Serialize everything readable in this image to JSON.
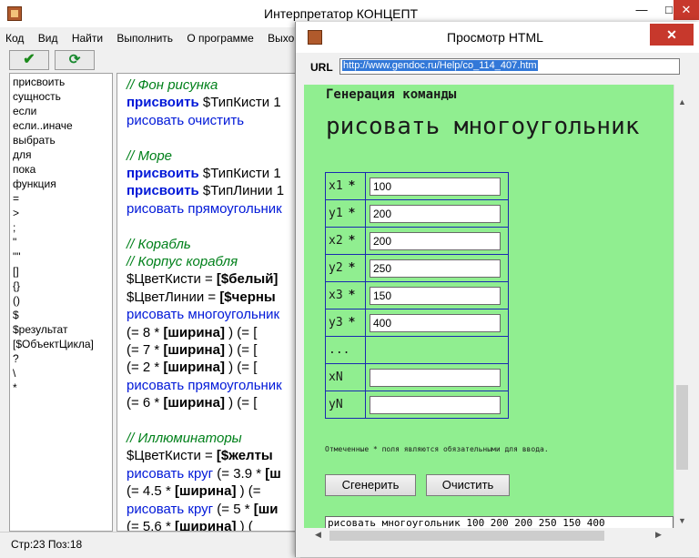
{
  "main": {
    "title": "Интерпретатор КОНЦЕПТ",
    "window_buttons": {
      "min": "—",
      "max": "□",
      "close": "✕"
    },
    "menu": [
      "Код",
      "Вид",
      "Найти",
      "Выполнить",
      "О программе",
      "Выхо"
    ],
    "toolbar": {
      "run_icon": "checkmark-icon",
      "refresh_icon": "refresh-icon",
      "run_glyph": "✔",
      "refresh_glyph": "⟳"
    },
    "keywords": [
      "присвоить",
      "сущность",
      "если",
      "если..иначе",
      "выбрать",
      "для",
      "пока",
      "функция",
      "=",
      ">",
      ";",
      "\"",
      "\"\"",
      "[]",
      "{}",
      "()",
      "$",
      "$результат",
      "[$ОбъектЦикла]",
      "?",
      "\\",
      "*"
    ],
    "editor_lines": [
      {
        "parts": [
          {
            "cls": "cmt",
            "text": "// Фон рисунка"
          }
        ]
      },
      {
        "parts": [
          {
            "cls": "kw",
            "text": "присвоить"
          },
          {
            "cls": "",
            "text": " $ТипКисти 1"
          }
        ]
      },
      {
        "parts": [
          {
            "cls": "cmd",
            "text": "рисовать очистить"
          }
        ]
      },
      {
        "parts": []
      },
      {
        "parts": [
          {
            "cls": "cmt",
            "text": "// Море"
          }
        ]
      },
      {
        "parts": [
          {
            "cls": "kw",
            "text": "присвоить"
          },
          {
            "cls": "",
            "text": " $ТипКисти 1"
          }
        ]
      },
      {
        "parts": [
          {
            "cls": "kw",
            "text": "присвоить"
          },
          {
            "cls": "",
            "text": " $ТипЛинии 1"
          }
        ]
      },
      {
        "parts": [
          {
            "cls": "cmd",
            "text": "рисовать прямоугольник"
          }
        ]
      },
      {
        "parts": []
      },
      {
        "parts": [
          {
            "cls": "cmt",
            "text": "// Корабль"
          }
        ]
      },
      {
        "parts": [
          {
            "cls": "cmt",
            "text": "// Корпус корабля"
          }
        ]
      },
      {
        "parts": [
          {
            "cls": "",
            "text": "$ЦветКисти = "
          },
          {
            "cls": "blk",
            "text": "[$белый]"
          }
        ]
      },
      {
        "parts": [
          {
            "cls": "",
            "text": "$ЦветЛинии = "
          },
          {
            "cls": "blk",
            "text": "[$черны"
          }
        ]
      },
      {
        "parts": [
          {
            "cls": "cmd",
            "text": "рисовать многоугольник"
          }
        ]
      },
      {
        "parts": [
          {
            "cls": "",
            "text": "  (= 8 * "
          },
          {
            "cls": "blk",
            "text": "[ширина]"
          },
          {
            "cls": "",
            "text": " ) (= ["
          }
        ]
      },
      {
        "parts": [
          {
            "cls": "",
            "text": "  (= 7 * "
          },
          {
            "cls": "blk",
            "text": "[ширина]"
          },
          {
            "cls": "",
            "text": " ) (= ["
          }
        ]
      },
      {
        "parts": [
          {
            "cls": "",
            "text": "  (= 2 * "
          },
          {
            "cls": "blk",
            "text": "[ширина]"
          },
          {
            "cls": "",
            "text": " ) (= ["
          }
        ]
      },
      {
        "parts": [
          {
            "cls": "cmd",
            "text": "рисовать прямоугольник"
          }
        ]
      },
      {
        "parts": [
          {
            "cls": "",
            "text": "  (= 6 * "
          },
          {
            "cls": "blk",
            "text": "[ширина]"
          },
          {
            "cls": "",
            "text": " ) (= ["
          }
        ]
      },
      {
        "parts": []
      },
      {
        "parts": [
          {
            "cls": "cmt",
            "text": "// Иллюминаторы"
          }
        ]
      },
      {
        "parts": [
          {
            "cls": "",
            "text": "$ЦветКисти = "
          },
          {
            "cls": "blk",
            "text": "[$желты"
          }
        ]
      },
      {
        "parts": [
          {
            "cls": "cmd",
            "text": "рисовать круг"
          },
          {
            "cls": "",
            "text": " (= 3.9 * "
          },
          {
            "cls": "blk",
            "text": "[ш"
          }
        ]
      },
      {
        "parts": [
          {
            "cls": "",
            "text": "  (= 4.5 * "
          },
          {
            "cls": "blk",
            "text": "[ширина]"
          },
          {
            "cls": "",
            "text": " ) (="
          }
        ]
      },
      {
        "parts": [
          {
            "cls": "cmd",
            "text": "рисовать круг"
          },
          {
            "cls": "",
            "text": " (= 5 * "
          },
          {
            "cls": "blk",
            "text": "[ши"
          }
        ]
      },
      {
        "parts": [
          {
            "cls": "",
            "text": "  (= 5.6 * "
          },
          {
            "cls": "blk",
            "text": "[ширина]"
          },
          {
            "cls": "",
            "text": " ) ("
          }
        ]
      }
    ],
    "status": "Стр:23 Поз:18"
  },
  "viewer": {
    "title": "Просмотр HTML",
    "close": "✕",
    "url_label": "URL",
    "url": "http://www.gendoc.ru/Help/co_114_407.htm",
    "subtitle": "Генерация команды",
    "heading": "рисовать многоугольник",
    "params": [
      {
        "name": "x1",
        "required": "*",
        "value": "100"
      },
      {
        "name": "y1",
        "required": "*",
        "value": "200"
      },
      {
        "name": "x2",
        "required": "*",
        "value": "200"
      },
      {
        "name": "y2",
        "required": "*",
        "value": "250"
      },
      {
        "name": "x3",
        "required": "*",
        "value": "150"
      },
      {
        "name": "y3",
        "required": "*",
        "value": "400"
      },
      {
        "name": "...",
        "required": "",
        "value": null
      },
      {
        "name": "xN",
        "required": "",
        "value": ""
      },
      {
        "name": "yN",
        "required": "",
        "value": ""
      }
    ],
    "note": "Отмеченные * поля являются обязательными для ввода.",
    "generate_label": "Сгенерить",
    "clear_label": "Очистить",
    "result": "рисовать многоугольник 100 200 200 250 150 400"
  }
}
